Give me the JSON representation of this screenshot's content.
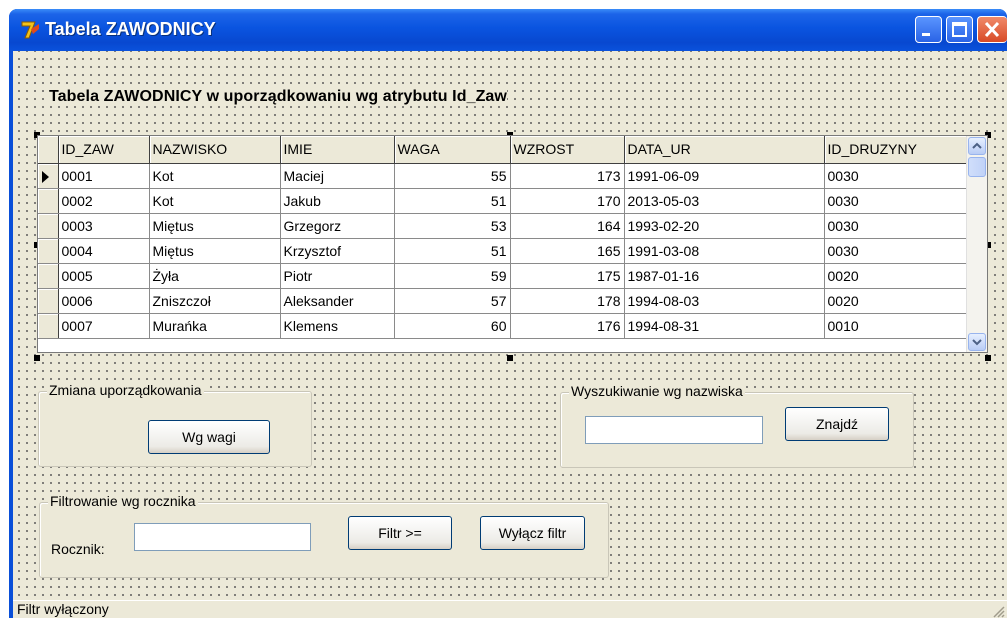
{
  "window": {
    "title": "Tabela ZAWODNICY",
    "controls": [
      "minimize-icon",
      "maximize-icon",
      "close-icon"
    ]
  },
  "heading": "Tabela ZAWODNICY w uporządkowaniu wg atrybutu Id_Zaw",
  "table": {
    "columns": [
      "ID_ZAW",
      "NAZWISKO",
      "IMIE",
      "WAGA",
      "WZROST",
      "DATA_UR",
      "ID_DRUZYNY"
    ],
    "rows": [
      [
        "0001",
        "Kot",
        "Maciej",
        "55",
        "173",
        "1991-06-09",
        "0030"
      ],
      [
        "0002",
        "Kot",
        "Jakub",
        "51",
        "170",
        "2013-05-03",
        "0030"
      ],
      [
        "0003",
        "Miętus",
        "Grzegorz",
        "53",
        "164",
        "1993-02-20",
        "0030"
      ],
      [
        "0004",
        "Miętus",
        "Krzysztof",
        "51",
        "165",
        "1991-03-08",
        "0030"
      ],
      [
        "0005",
        "Żyła",
        "Piotr",
        "59",
        "175",
        "1987-01-16",
        "0020"
      ],
      [
        "0006",
        "Zniszczoł",
        "Aleksander",
        "57",
        "178",
        "1994-08-03",
        "0020"
      ],
      [
        "0007",
        "Murańka",
        "Klemens",
        "60",
        "176",
        "1994-08-31",
        "0010"
      ]
    ],
    "current_row": 0
  },
  "order_group": {
    "label": "Zmiana uporządkowania",
    "button": "Wg wagi"
  },
  "search_group": {
    "label": "Wyszukiwanie wg nazwiska",
    "input_value": "",
    "button": "Znajdź"
  },
  "filter_group": {
    "label": "Filtrowanie wg rocznika",
    "field_label": "Rocznik:",
    "input_value": "",
    "filter_button": "Filtr >=",
    "clear_button": "Wyłącz filtr"
  },
  "status": "Filtr wyłączony",
  "colors": {
    "titlebar": "#0a54e0",
    "form_bg": "#ece9d8",
    "button_border": "#003c74"
  }
}
